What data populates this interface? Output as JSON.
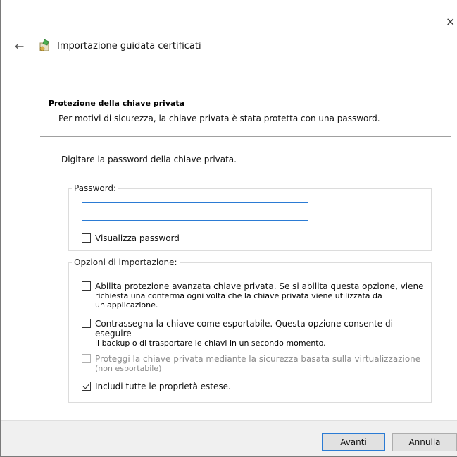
{
  "window": {
    "close_glyph": "×",
    "back_glyph": "←",
    "title": "Importazione guidata certificati",
    "icon": "certificate-wizard-icon"
  },
  "section": {
    "title": "Protezione della chiave privata",
    "description": "Per motivi di sicurezza, la chiave privata è stata protetta con una password."
  },
  "instruction": "Digitare la password della chiave privata.",
  "password_group": {
    "legend": "Password:",
    "input_value": "",
    "show_password_label": "Visualizza password",
    "show_password_checked": false
  },
  "options_group": {
    "legend": "Opzioni di importazione:",
    "options": [
      {
        "label": "Abilita protezione avanzata chiave privata. Se si abilita questa opzione, viene",
        "sub": "richiesta una conferma ogni volta che la chiave privata viene utilizzata da un'applicazione.",
        "checked": false,
        "enabled": true
      },
      {
        "label": "Contrassegna la chiave come esportabile. Questa opzione consente di eseguire",
        "sub": "il backup o di trasportare le chiavi in un secondo momento.",
        "checked": false,
        "enabled": true
      },
      {
        "label": "Proteggi la chiave privata mediante la sicurezza basata sulla virtualizzazione",
        "sub": "(non esportabile)",
        "checked": false,
        "enabled": false
      },
      {
        "label": "Includi tutte le proprietà estese.",
        "sub": "",
        "checked": true,
        "enabled": true
      }
    ]
  },
  "footer": {
    "next_label": "Avanti",
    "cancel_label": "Annulla"
  },
  "colors": {
    "accent": "#2b7bd4",
    "footer_bg": "#f0f0f0"
  }
}
